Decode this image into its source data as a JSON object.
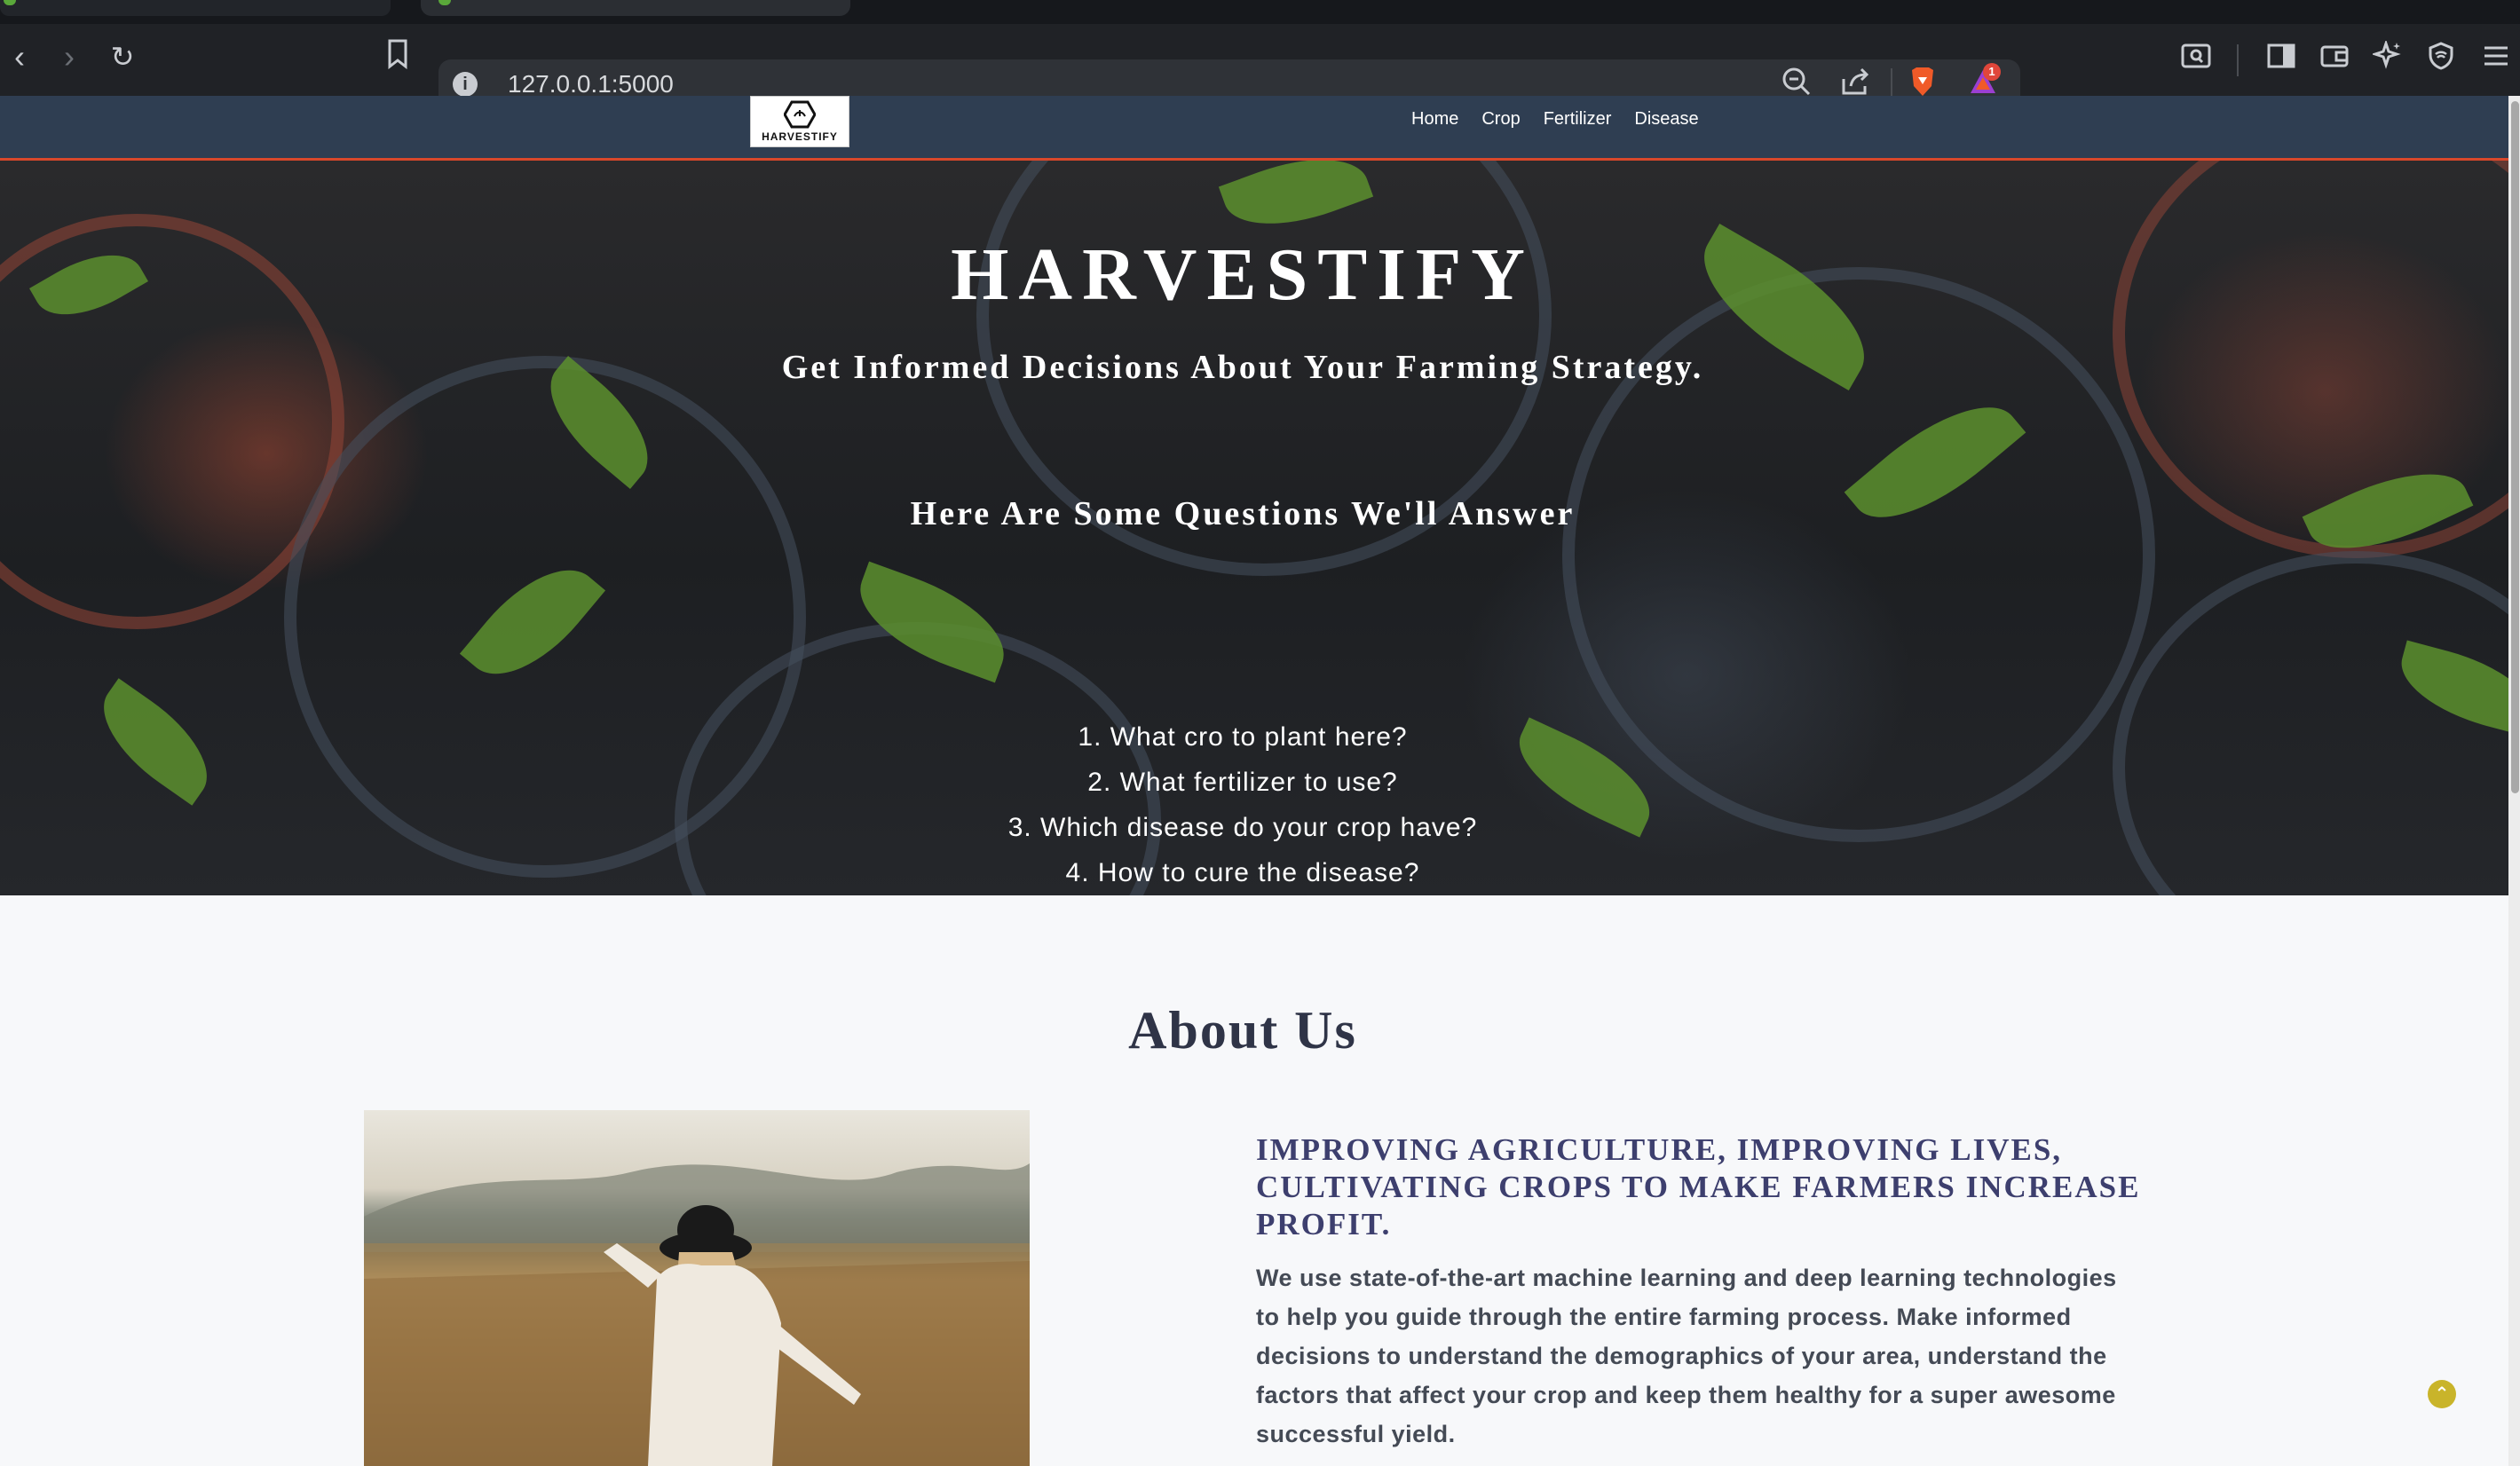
{
  "browser": {
    "url": "127.0.0.1:5000",
    "shields_badge": "1"
  },
  "site": {
    "logo_text": "HARVESTIFY",
    "nav": [
      {
        "label": "Home"
      },
      {
        "label": "Crop"
      },
      {
        "label": "Fertilizer"
      },
      {
        "label": "Disease"
      }
    ]
  },
  "hero": {
    "title": "HARVESTIFY",
    "subtitle": "Get Informed Decisions About Your Farming Strategy.",
    "questions_heading": "Here Are Some Questions We'll Answer",
    "questions": [
      "1. What cro to plant here?",
      "2. What fertilizer to use?",
      "3. Which disease do your crop have?",
      "4. How to cure the disease?"
    ]
  },
  "about": {
    "title": "About Us",
    "heading": "IMPROVING AGRICULTURE, IMPROVING LIVES, CULTIVATING CROPS TO MAKE FARMERS INCREASE PROFIT.",
    "body": "We use state-of-the-art machine learning and deep learning technologies to help you guide through the entire farming process. Make informed decisions to understand the demographics of your area, understand the factors that affect your crop and keep them healthy for a super awesome successful yield."
  },
  "colors": {
    "nav_bg": "#2f3e52",
    "nav_accent": "#d9482b",
    "about_heading": "#3d3f6e",
    "scroll_top": "#c9b42a"
  }
}
